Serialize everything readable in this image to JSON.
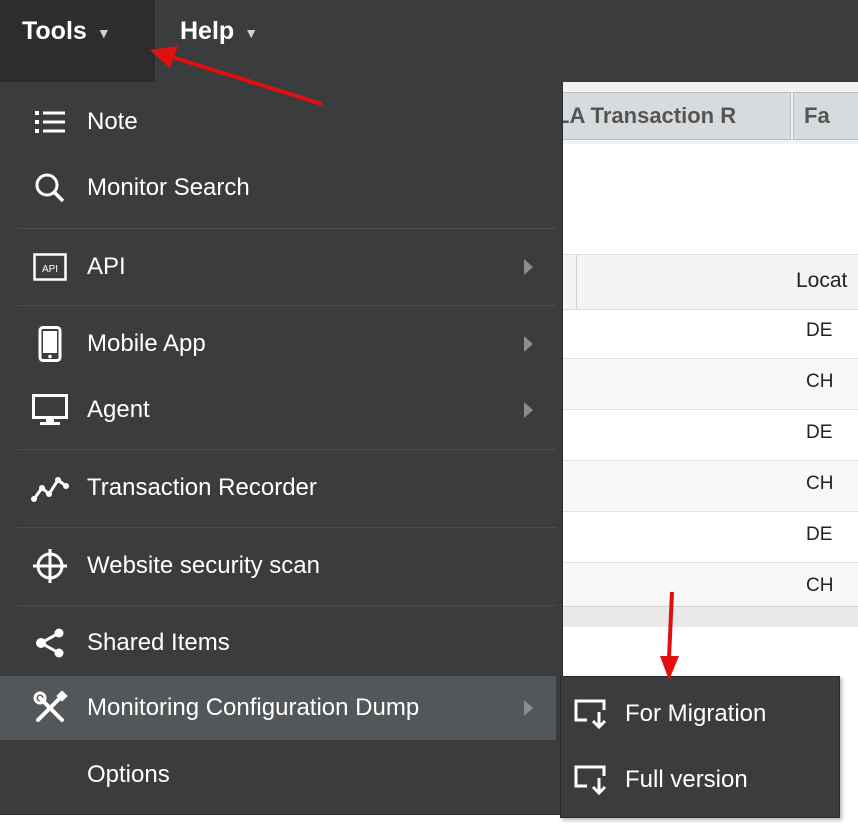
{
  "menubar": {
    "tools": "Tools",
    "help": "Help"
  },
  "background": {
    "tabs": [
      "LA Transaction R",
      "Fa"
    ],
    "table": {
      "header": "Locat",
      "rows": [
        "DE",
        "CH",
        "DE",
        "CH",
        "DE",
        "CH"
      ]
    }
  },
  "tools_menu": {
    "items": [
      {
        "label": "Note",
        "icon": "list-icon"
      },
      {
        "label": "Monitor Search",
        "icon": "search-icon"
      },
      {
        "label": "API",
        "icon": "api-icon",
        "submenu": true
      },
      {
        "label": "Mobile App",
        "icon": "mobile-icon",
        "submenu": true
      },
      {
        "label": "Agent",
        "icon": "monitor-icon",
        "submenu": true
      },
      {
        "label": "Transaction Recorder",
        "icon": "chart-line-icon"
      },
      {
        "label": "Website security scan",
        "icon": "crosshair-icon"
      },
      {
        "label": "Shared Items",
        "icon": "share-icon"
      },
      {
        "label": "Monitoring Configuration Dump",
        "icon": "tools-icon",
        "submenu": true,
        "active": true
      },
      {
        "label": "Options",
        "icon": ""
      }
    ]
  },
  "dump_submenu": {
    "items": [
      {
        "label": "For Migration",
        "icon": "download-screen-icon"
      },
      {
        "label": "Full version",
        "icon": "download-screen-icon"
      }
    ]
  },
  "colors": {
    "menu_bg": "#3a3c3e",
    "active_item": "#545759",
    "annotation_arrow": "#e01010"
  }
}
